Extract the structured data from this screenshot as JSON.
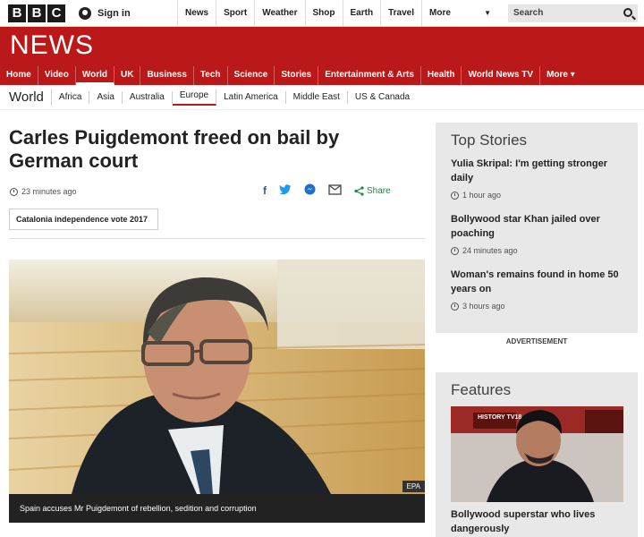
{
  "topbar": {
    "logo_letters": [
      "B",
      "B",
      "C"
    ],
    "signin_label": "Sign in",
    "nav": [
      "News",
      "Sport",
      "Weather",
      "Shop",
      "Earth",
      "Travel"
    ],
    "more_label": "More",
    "search_placeholder": "Search"
  },
  "newsbar": {
    "title": "NEWS",
    "nav": [
      "Home",
      "Video",
      "World",
      "UK",
      "Business",
      "Tech",
      "Science",
      "Stories",
      "Entertainment & Arts",
      "Health",
      "World News TV",
      "More ▾"
    ],
    "active": "World",
    "color": "#bb1919"
  },
  "subnav": {
    "section": "World",
    "items": [
      "Africa",
      "Asia",
      "Australia",
      "Europe",
      "Latin America",
      "Middle East",
      "US & Canada"
    ],
    "active": "Europe"
  },
  "article": {
    "headline": "Carles Puigdemont freed on bail by German court",
    "timestamp": "23 minutes ago",
    "share_label": "Share",
    "topic": "Catalonia independence vote 2017",
    "image_credit": "EPA",
    "caption": "Spain accuses Mr Puigdemont of rebellion, sedition and corruption"
  },
  "top_stories": {
    "title": "Top Stories",
    "items": [
      {
        "title": "Yulia Skripal: I'm getting stronger daily",
        "time": "1 hour ago"
      },
      {
        "title": "Bollywood star Khan jailed over poaching",
        "time": "24 minutes ago"
      },
      {
        "title": "Woman's remains found in home 50 years on",
        "time": "3 hours ago"
      }
    ]
  },
  "advertisement_label": "ADVERTISEMENT",
  "features": {
    "title": "Features",
    "item_title": "Bollywood superstar who lives dangerously",
    "image_sign_text": "HISTORY TV18"
  }
}
